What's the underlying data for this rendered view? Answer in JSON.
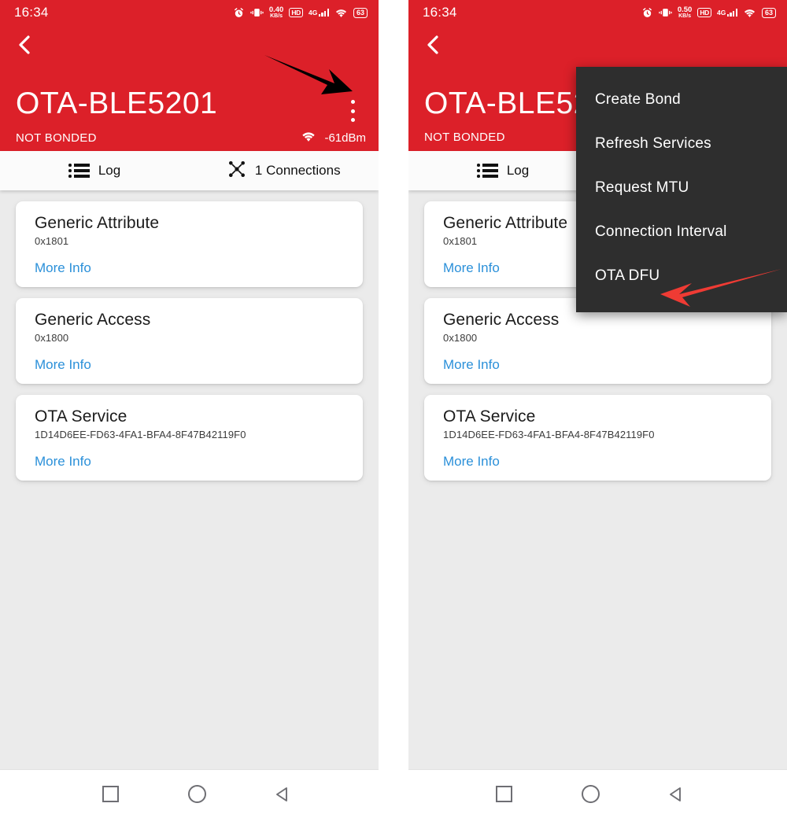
{
  "theme": {
    "accent": "#dc2029",
    "link": "#2b90d9",
    "menu_bg": "#2e2e2e",
    "content_bg": "#ebebeb",
    "black_arrow": "#000000",
    "red_arrow": "#ef3b34"
  },
  "left_panel": {
    "statusbar": {
      "time": "16:34",
      "net_speed_value": "0.40",
      "net_speed_unit": "KB/s",
      "hd_label": "HD",
      "network_label": "4G",
      "battery_level": "63",
      "icons": [
        "alarm-icon",
        "vibrate-icon",
        "network-speed-icon",
        "hd-icon",
        "signal-icon",
        "wifi-icon",
        "battery-icon"
      ]
    },
    "appbar": {
      "back_icon": "chevron-left-icon",
      "device_name": "OTA-BLE5201",
      "overflow_icon": "kebab-menu-icon",
      "bond_status": "NOT BONDED",
      "rssi": "-61dBm",
      "rssi_icon": "signal-strength-icon"
    },
    "tabs": [
      {
        "label": "Log",
        "icon": "list-icon",
        "active": true
      },
      {
        "label": "1 Connections",
        "icon": "connections-hub-icon",
        "active": false
      }
    ],
    "services": [
      {
        "title": "Generic Attribute",
        "uuid": "0x1801",
        "more": "More Info"
      },
      {
        "title": "Generic Access",
        "uuid": "0x1800",
        "more": "More Info"
      },
      {
        "title": "OTA Service",
        "uuid": "1D14D6EE-FD63-4FA1-BFA4-8F47B42119F0",
        "more": "More Info"
      }
    ]
  },
  "right_panel": {
    "statusbar": {
      "time": "16:34",
      "net_speed_value": "0.50",
      "net_speed_unit": "KB/s",
      "hd_label": "HD",
      "network_label": "4G",
      "battery_level": "63"
    },
    "appbar": {
      "back_icon": "chevron-left-icon",
      "device_name": "OTA-BLE5201",
      "bond_status": "NOT BONDED"
    },
    "tabs": [
      {
        "label": "Log",
        "icon": "list-icon",
        "active": true
      },
      {
        "label": "1 Connections",
        "icon": "connections-hub-icon",
        "active": false
      }
    ],
    "services": [
      {
        "title": "Generic Attribute",
        "uuid": "0x1801",
        "more": "More Info"
      },
      {
        "title": "Generic Access",
        "uuid": "0x1800",
        "more": "More Info"
      },
      {
        "title": "OTA Service",
        "uuid": "1D14D6EE-FD63-4FA1-BFA4-8F47B42119F0",
        "more": "More Info"
      }
    ],
    "overflow_menu": {
      "items": [
        "Create Bond",
        "Refresh Services",
        "Request MTU",
        "Connection Interval",
        "OTA DFU"
      ]
    }
  },
  "navbar": {
    "buttons": [
      {
        "name": "recents-button",
        "icon": "square-icon"
      },
      {
        "name": "home-button",
        "icon": "circle-icon"
      },
      {
        "name": "back-button",
        "icon": "triangle-left-icon"
      }
    ]
  },
  "annotations": [
    {
      "name": "black-arrow",
      "points_to": "overflow-menu-button",
      "color": "#000000"
    },
    {
      "name": "red-arrow",
      "points_to": "menu-item-ota-dfu",
      "color": "#ef3b34"
    }
  ]
}
